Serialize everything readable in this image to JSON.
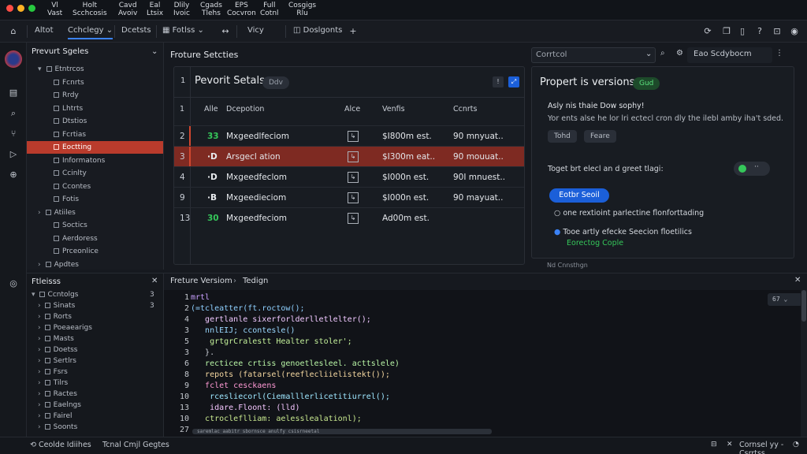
{
  "window": {
    "menu": [
      {
        "line1": "Vl",
        "line2": "Vast"
      },
      {
        "line1": "Holt",
        "line2": "Scchcosis"
      },
      {
        "line1": "Cavd",
        "line2": "Avoiv"
      },
      {
        "line1": "Eal",
        "line2": "Ltsix"
      },
      {
        "line1": "Dlily",
        "line2": "Ivoic"
      },
      {
        "line1": "Cgads",
        "line2": "Tlehs"
      },
      {
        "line1": "EPS",
        "line2": "Cocvron"
      },
      {
        "line1": "Full",
        "line2": "Cotnl"
      },
      {
        "line1": "Cosgigs",
        "line2": "Rlu"
      }
    ]
  },
  "toolbar": {
    "items": [
      "Altot",
      "Cchclegy",
      "Dcetsts",
      "Fotlss",
      "Vicy",
      "Doslgonts"
    ],
    "right_icons": [
      "sync-icon",
      "copy-icon",
      "clipboard-icon",
      "help-icon",
      "lock-icon",
      "user-icon"
    ]
  },
  "sidebar": {
    "title": "Prevurt Sgeles",
    "tree": [
      {
        "label": "Etntrcos",
        "indent": 1,
        "arrow": "▾"
      },
      {
        "label": "Fcnrts",
        "indent": 2
      },
      {
        "label": "Rrdy",
        "indent": 2
      },
      {
        "label": "Lhtrts",
        "indent": 2
      },
      {
        "label": "Dtstios",
        "indent": 2
      },
      {
        "label": "Fcrtias",
        "indent": 2
      },
      {
        "label": "Eoctting",
        "indent": 2,
        "selected": true
      },
      {
        "label": "Informatons",
        "indent": 2
      },
      {
        "label": "Ccinlty",
        "indent": 2
      },
      {
        "label": "Ccontes",
        "indent": 2
      },
      {
        "label": "Fotis",
        "indent": 2
      },
      {
        "label": "Atiiles",
        "indent": 1,
        "arrow": "›"
      },
      {
        "label": "Soctics",
        "indent": 2
      },
      {
        "label": "Aerdoress",
        "indent": 2
      },
      {
        "label": "Prceonlice",
        "indent": 2
      },
      {
        "label": "Apdtes",
        "indent": 1,
        "arrow": "›"
      }
    ]
  },
  "sidebar2": {
    "title": "Ftleisss",
    "tree": [
      {
        "label": "Ccntolgs",
        "count": "3",
        "arrow": "▾",
        "indent": 0
      },
      {
        "label": "Sinats",
        "count": "3",
        "arrow": "›",
        "indent": 1
      },
      {
        "label": "Rorts",
        "arrow": "›",
        "indent": 1
      },
      {
        "label": "Poeaearigs",
        "arrow": "›",
        "indent": 1
      },
      {
        "label": "Masts",
        "arrow": "›",
        "indent": 1
      },
      {
        "label": "Doetss",
        "arrow": "›",
        "indent": 1
      },
      {
        "label": "Sertlrs",
        "arrow": "›",
        "indent": 1
      },
      {
        "label": "Fsrs",
        "arrow": "›",
        "indent": 1
      },
      {
        "label": "Tilrs",
        "arrow": "›",
        "indent": 1
      },
      {
        "label": "Ractes",
        "arrow": "›",
        "indent": 1
      },
      {
        "label": "Eaelngs",
        "arrow": "›",
        "indent": 1
      },
      {
        "label": "Fairel",
        "arrow": "›",
        "indent": 1
      },
      {
        "label": "Soonts",
        "arrow": "›",
        "indent": 1
      }
    ]
  },
  "content": {
    "title": "Froture Setcties",
    "search_placeholder": "Corrtcol",
    "search_right": "Eao Scdybocm",
    "table": {
      "title": "Pevorit Setals",
      "badge": "Ddv",
      "count": "1",
      "columns": [
        "Alle",
        "Dcepotion",
        "Alce",
        "Venfis",
        "Ccnrts"
      ],
      "header_num": "1",
      "rows": [
        {
          "num": "2",
          "tag": "33",
          "tag_color": "#35c75a",
          "desc": "Mxgeedlfeciom",
          "value": "$I800m est.",
          "count": "90 mnyuat..",
          "selected": false
        },
        {
          "num": "3",
          "tag": "·D",
          "tag_color": "#e9ecef",
          "desc": "Arsgecl ation",
          "value": "$I300m eat..",
          "count": "90 mouuat..",
          "selected": true
        },
        {
          "num": "4",
          "tag": "·D",
          "tag_color": "#e9ecef",
          "desc": "Mxgeedfeclom",
          "value": "$I000n est.",
          "count": "90I mnuest..",
          "selected": false
        },
        {
          "num": "9",
          "tag": "·B",
          "tag_color": "#e9ecef",
          "desc": "Mxgeedieciom",
          "value": "$I000n est.",
          "count": "90 mayuat..",
          "selected": false
        },
        {
          "num": "13",
          "tag": "30",
          "tag_color": "#35c75a",
          "desc": "Mxgeedfeciom",
          "value": "Ad00m est.",
          "count": "",
          "selected": false
        }
      ]
    },
    "props": {
      "title": "Propert is versions",
      "badge": "Gud",
      "desc_line1": "Asly nis thaie Dow sophy!",
      "desc_line2": "Yor ents alse he lor lri ectecl cron dly the ilebl amby iha't sded.",
      "chip1": "Tohd",
      "chip2": "Feare",
      "toggle_label": "Toget brt elecl an d greet tlagi:",
      "button": "Eotbr Seoil",
      "radio1": "one rextioint parlectine flonforttading",
      "radio2_line1": "Tooe artly efecke Seecion floetilics",
      "radio2_line2": "Eorectog Cople",
      "footer": "Nd Cnnsthgn"
    }
  },
  "editor": {
    "breadcrumb1": "Freture Versiom",
    "breadcrumb2": "Tedign",
    "zoom": "67",
    "lines": [
      {
        "n": "1",
        "text": "mrtl",
        "color": "#c9a0ff"
      },
      {
        "n": "2",
        "text": "(=tcleatter(ft.roctow();",
        "color": "#8fd0ff"
      },
      {
        "n": "4",
        "text": "   gertlanle sixerforlderlletlelter();",
        "color": "#f0c8ff"
      },
      {
        "n": "3",
        "text": "   nnlEIJ; ccontesle()",
        "color": "#9ad8ff"
      },
      {
        "n": "5",
        "text": "    grtgrCralestt Healter stoler';",
        "color": "#c3f09a"
      },
      {
        "n": "3",
        "text": "   }.",
        "color": "#c9ced6"
      },
      {
        "n": "6",
        "text": "   recticee crtiss genoetlesleel. acttslele)",
        "color": "#b8f5a6"
      },
      {
        "n": "8",
        "text": "   repots (fatarsel(reeflecliielistekt());",
        "color": "#f4d7a0"
      },
      {
        "n": "9",
        "text": "   fclet cesckaens",
        "color": "#ff9ad5"
      },
      {
        "n": "10",
        "text": "    rcesliecorl(Ciemalllerlicetitiurrel();",
        "color": "#9ee7ff"
      },
      {
        "n": "13",
        "text": "    idare.Floont: (lld)",
        "color": "#f5c6ff"
      },
      {
        "n": "10",
        "text": "   ctrocleflliam: aelesslealationl);",
        "color": "#c8e88f"
      },
      {
        "n": "27",
        "text": "",
        "color": "#c9ced6"
      }
    ],
    "minimap_text": "saremlac aabitr sbornsce anulfy csisrneetal"
  },
  "status": {
    "left1": "Ceolde Idiihes",
    "left2": "Tcnal Cmjl Gegtes",
    "right": "Cornsel yy - Csrrtss"
  },
  "colors": {
    "accent": "#b93b2c",
    "selected_row": "#7e2a22",
    "button": "#1b5fd9",
    "green": "#35c75a"
  }
}
